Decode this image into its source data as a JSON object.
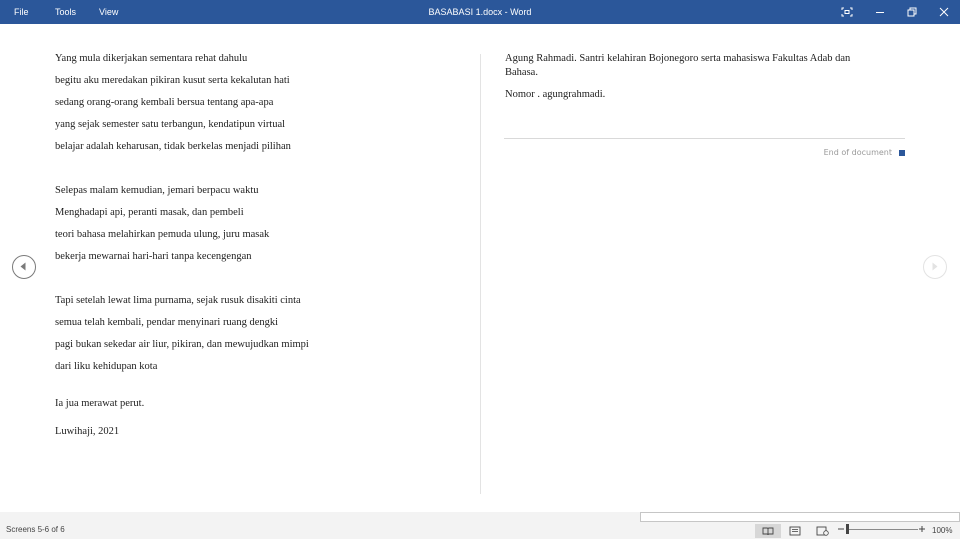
{
  "app": {
    "title": "BASABASI  1.docx - Word",
    "menu": [
      "File",
      "Tools",
      "View"
    ]
  },
  "window_controls": [
    "focus-icon",
    "minimize-icon",
    "restore-icon",
    "close-icon"
  ],
  "left_page": {
    "stanza1": [
      "Yang mula dikerjakan sementara rehat dahulu",
      "begitu aku meredakan pikiran kusut serta kekalutan hati",
      "sedang orang-orang kembali bersua tentang apa-apa",
      "yang sejak semester satu terbangun, kendatipun virtual",
      "belajar adalah keharusan, tidak berkelas menjadi pilihan"
    ],
    "stanza2": [
      "Selepas malam kemudian, jemari berpacu waktu",
      "Menghadapi api, peranti masak, dan pembeli",
      "teori bahasa melahirkan pemuda ulung, juru masak",
      "bekerja mewarnai hari-hari tanpa kecengengan"
    ],
    "stanza3": [
      "Tapi setelah lewat lima purnama, sejak rusuk disakiti cinta",
      "semua telah kembali, pendar menyinari ruang dengki",
      "pagi bukan sekedar air liur, pikiran, dan mewujudkan mimpi",
      "dari liku kehidupan kota"
    ],
    "closing": "Ia jua merawat perut.",
    "signature": "Luwihaji, 2021"
  },
  "right_page": {
    "bio_line1": "Agung Rahmadi. Santri kelahiran Bojonegoro serta mahasiswa Fakultas Adab dan",
    "bio_line2": "Bahasa.",
    "contact": "Nomor . agungrahmadi.",
    "end_of_document": "End of document"
  },
  "status": {
    "screens": "Screens 5-6 of 6",
    "zoom": "100%",
    "zoom_level": 0.5
  },
  "colors": {
    "title_bar": "#2b579a",
    "end_marker": "#2b579a"
  }
}
